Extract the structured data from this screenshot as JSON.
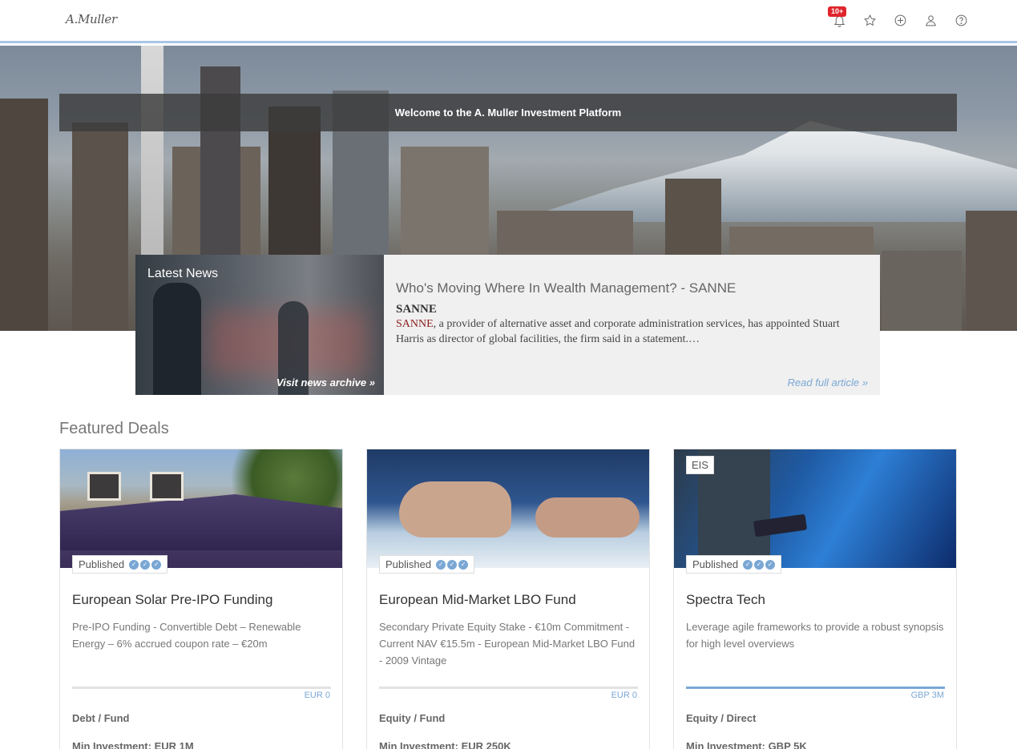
{
  "header": {
    "logo": "A.Muller",
    "notification_badge": "10+",
    "icons": [
      "bell-icon",
      "star-icon",
      "plus-circle-icon",
      "user-icon",
      "help-icon"
    ]
  },
  "hero": {
    "welcome": "Welcome to the A. Muller Investment Platform"
  },
  "news": {
    "section_label": "Latest News",
    "archive_link": "Visit news archive »",
    "headline": "Who's Moving Where In Wealth Management? - SANNE",
    "source": "SANNE",
    "body_link": "SANNE",
    "body": ", a provider of alternative asset and corporate administration services, has appointed Stuart Harris as director of global facilities, the firm said in a statement.…",
    "read_more": "Read full article »"
  },
  "featured": {
    "title": "Featured Deals",
    "deals": [
      {
        "status": "Published",
        "tag": "",
        "title": "European Solar Pre-IPO Funding",
        "description": "Pre-IPO Funding - Convertible Debt – Renewable Energy – 6% accrued coupon rate – €20m",
        "amount": "EUR 0",
        "progress": 0,
        "type": "Debt / Fund",
        "min_investment": "Min Investment: EUR 1M"
      },
      {
        "status": "Published",
        "tag": "",
        "title": "European Mid-Market LBO Fund",
        "description": "Secondary Private Equity Stake - €10m Commitment - Current NAV €15.5m - European Mid-Market LBO Fund - 2009 Vintage",
        "amount": "EUR 0",
        "progress": 0,
        "type": "Equity / Fund",
        "min_investment": "Min Investment: EUR 250K"
      },
      {
        "status": "Published",
        "tag": "EIS",
        "title": "Spectra Tech",
        "description": "Leverage agile frameworks to provide a robust synopsis for high level overviews",
        "amount": "GBP 3M",
        "progress": 100,
        "type": "Equity / Direct",
        "min_investment": "Min Investment: GBP 5K"
      }
    ]
  },
  "colors": {
    "accent": "#7aa7d4",
    "badge": "#e0242b",
    "header_border": "#a9c6e6"
  }
}
